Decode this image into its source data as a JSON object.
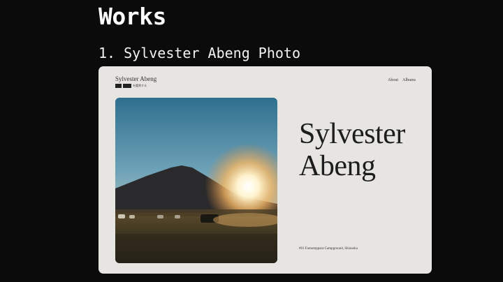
{
  "slide": {
    "title": "Works",
    "item_heading": "1. Sylvester Abeng Photo"
  },
  "site": {
    "logo_name": "Sylvester Abeng",
    "logo_tag_text": "を鑑賞する",
    "nav": [
      "About",
      "Albums"
    ],
    "hero_name_line1": "Sylvester",
    "hero_name_line2": "Abeng",
    "caption": "#01 Fumotoppara Campground, Shizuoka"
  },
  "colors": {
    "page_background": "#0b0b0b",
    "card_background": "#e6e5e1",
    "text_dark": "#1d1d1d"
  }
}
